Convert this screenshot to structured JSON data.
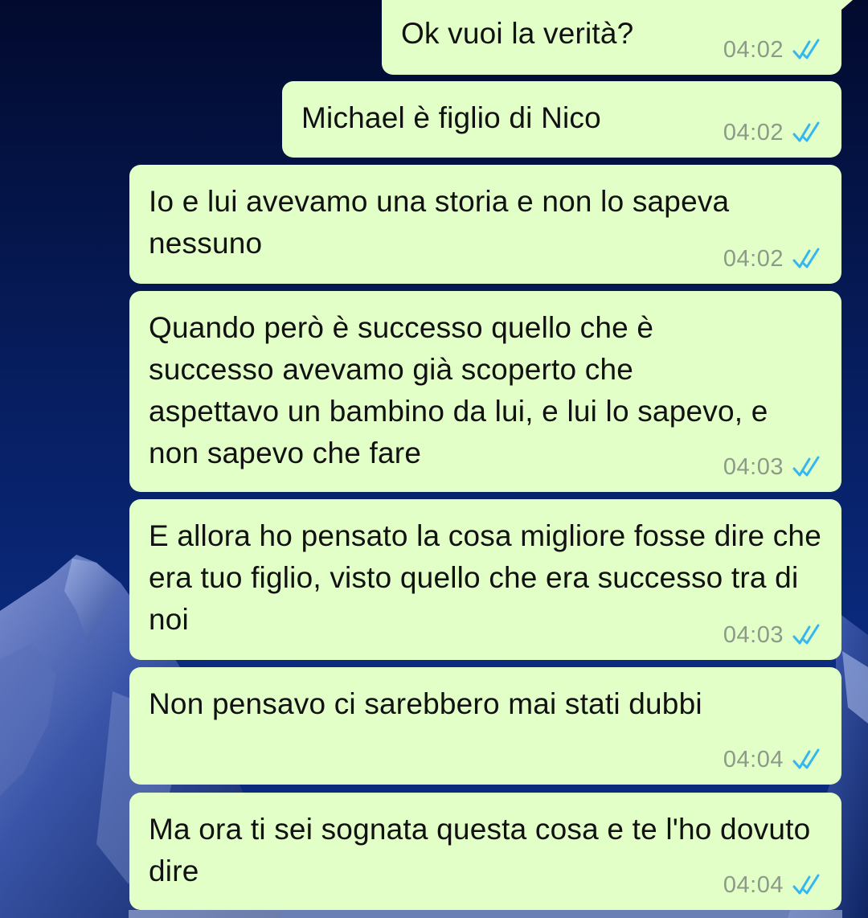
{
  "messages": [
    {
      "text": "Ok vuoi la verità?",
      "time": "04:02",
      "status": "read"
    },
    {
      "text": "Michael è figlio di Nico",
      "time": "04:02",
      "status": "read"
    },
    {
      "text": "Io e lui avevamo una storia e non lo sapeva nessuno",
      "time": "04:02",
      "status": "read"
    },
    {
      "text": "Quando però è successo quello che è successo avevamo già scoperto che aspettavo un bambino da lui, e lui lo sapevo, e non sapevo che fare",
      "time": "04:03",
      "status": "read"
    },
    {
      "text": "E allora ho pensato la cosa migliore fosse dire che era tuo figlio, visto quello che era successo tra di noi",
      "time": "04:03",
      "status": "read"
    },
    {
      "text": "Non pensavo ci sarebbero mai stati dubbi",
      "time": "04:04",
      "status": "read"
    },
    {
      "text": "Ma ora ti sei sognata questa cosa e te l'ho dovuto dire",
      "time": "04:04",
      "status": "read"
    }
  ],
  "colors": {
    "bubble_outgoing": "#e2ffc8",
    "read_ticks": "#34b7f1",
    "time_text": "#8d9a88",
    "wallpaper_sky": "#04123f"
  },
  "icons": {
    "read_receipt": "double-check-icon"
  }
}
